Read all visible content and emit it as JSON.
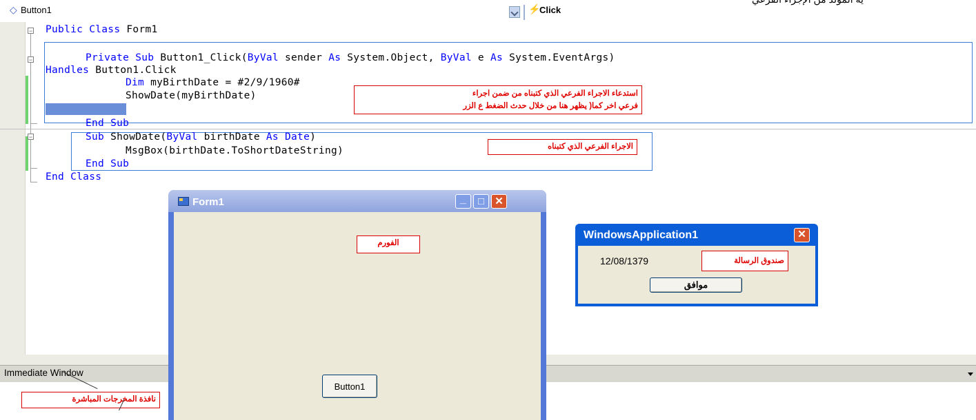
{
  "combobar": {
    "object_combo": "Button1",
    "event_combo": "Click",
    "top_arabic": "ية المولد من الإجراء الفرعي"
  },
  "code": {
    "line1": "Public Class Form1",
    "line2_a": "Private Sub",
    "line2_b": " Button1_Click(",
    "line2_c": "ByVal",
    "line2_d": " sender ",
    "line2_e": "As",
    "line2_f": " System.Object, ",
    "line2_g": "ByVal",
    "line2_h": " e ",
    "line2_i": "As",
    "line2_j": " System.EventArgs)",
    "line3_a": "Handles",
    "line3_b": " Button1.Click",
    "line4_a": "Dim",
    "line4_b": " myBirthDate = #2/9/1960#",
    "line5": "ShowDate(myBirthDate)",
    "line6": "End Sub",
    "line7_a": "Sub",
    "line7_b": " ShowDate(",
    "line7_c": "ByVal",
    "line7_d": " birthDate ",
    "line7_e": "As",
    "line7_f": " ",
    "line7_g": "Date",
    "line7_h": ")",
    "line8": "MsgBox(birthDate.ToShortDateString)",
    "line9": "End Sub",
    "line10": "End Class"
  },
  "annotations": {
    "call_note_1": "استدعاء الاجراء الفرعي الذي كتبناه من ضمن اجراء",
    "call_note_2": "فرعي اخر كما( يظهر هنا من خلال حدث الضغط ع الزر",
    "sub_note": "الاجراء الفرعي الذي كتبناه",
    "form_note": "الفورم",
    "msgbox_note": "صندوق الرسالة",
    "immediate_note": "نافذة المخرجات المباشرة"
  },
  "form1": {
    "caption": "Form1",
    "button_label": "Button1",
    "min_glyph": "_",
    "max_glyph": "□",
    "close_glyph": "✕"
  },
  "msgbox": {
    "caption": "WindowsApplication1",
    "message": "12/08/1379",
    "ok_label": "موافق",
    "close_glyph": "✕"
  },
  "immediate": {
    "title": "Immediate Window"
  },
  "colors": {
    "keyword": "#0000ff",
    "annotation_red": "#e00000",
    "highlight_box": "#3b7ed9",
    "xp_titlebar": "#0b5ed8"
  }
}
